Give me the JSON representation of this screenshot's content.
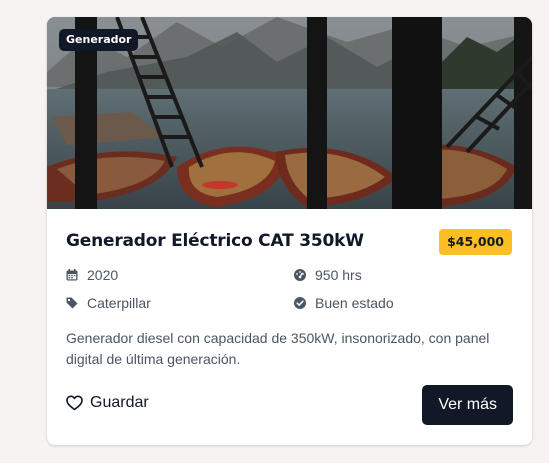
{
  "listing": {
    "category_badge": "Generador",
    "title": "Generador Eléctrico CAT 350kW",
    "price": "$45,000",
    "specs": {
      "year": "2020",
      "hours": "950 hrs",
      "brand": "Caterpillar",
      "condition": "Buen estado"
    },
    "description": "Generador diesel con capacidad de 350kW, insonorizado, con panel digital de última generación.",
    "save_label": "Guardar",
    "more_label": "Ver más"
  },
  "icons": {
    "year": "calendar-icon",
    "hours": "gauge-icon",
    "brand": "tag-icon",
    "condition": "check-circle-icon",
    "save": "heart-icon"
  },
  "colors": {
    "price_badge": "#fbbf24",
    "dark": "#111827",
    "text_muted": "#4b5563"
  }
}
